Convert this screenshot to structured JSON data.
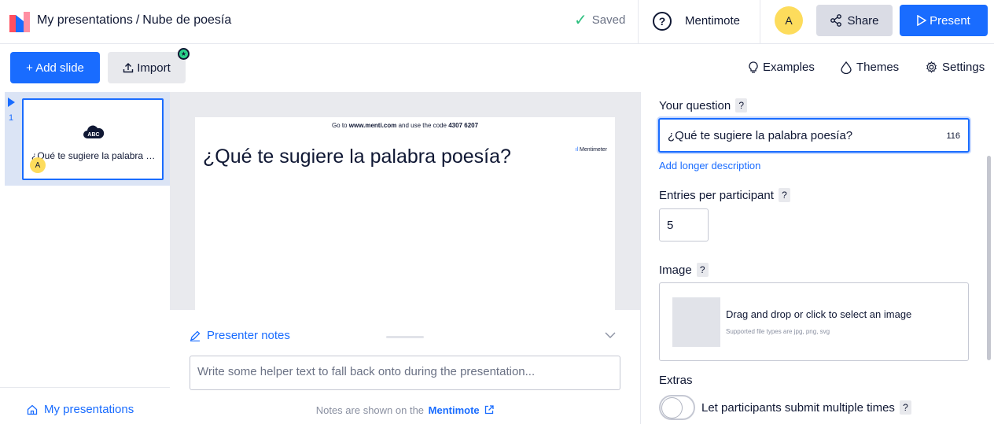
{
  "header": {
    "breadcrumb_root": "My presentations",
    "breadcrumb_separator": "/",
    "presentation_name": "Nube de poesía",
    "saved_label": "Saved",
    "help_glyph": "?",
    "mentimote_label": "Mentimote",
    "avatar_initial": "A",
    "share_label": "Share",
    "present_label": "Present"
  },
  "toolbar": {
    "add_slide_label": "+ Add slide",
    "import_label": "Import",
    "examples_label": "Examples",
    "themes_label": "Themes",
    "settings_label": "Settings"
  },
  "slides": [
    {
      "number": "1",
      "icon": "word-cloud-abc-icon",
      "icon_text": "ABC",
      "title": "¿Qué te sugiere la palabra poesía?",
      "avatar_initial": "A"
    }
  ],
  "sidebar": {
    "my_presentations_label": "My presentations"
  },
  "preview": {
    "code_prefix": "Go to",
    "code_url": "www.menti.com",
    "code_middle": "and use the code",
    "code_value": "4307 6207",
    "title": "¿Qué te sugiere la palabra poesía?",
    "brand": "Mentimeter"
  },
  "notes": {
    "header_label": "Presenter notes",
    "placeholder": "Write some helper text to fall back onto during the presentation...",
    "footer_prefix": "Notes are shown on the",
    "footer_link": "Mentimote"
  },
  "editor": {
    "question_label": "Your question",
    "question_value": "¿Qué te sugiere la palabra poesía?",
    "question_remaining": "116",
    "add_description_label": "Add longer description",
    "entries_label": "Entries per participant",
    "entries_value": "5",
    "image_label": "Image",
    "image_drop_main": "Drag and drop or click to select an image",
    "image_drop_sub": "Supported file types are jpg, png, svg",
    "extras_label": "Extras",
    "multiple_submissions_label": "Let participants submit multiple times",
    "multiple_submissions_enabled": false,
    "help_glyph": "?"
  },
  "colors": {
    "accent": "#196cff",
    "avatar": "#fddc5c",
    "saved_check": "#2bbf7e"
  }
}
